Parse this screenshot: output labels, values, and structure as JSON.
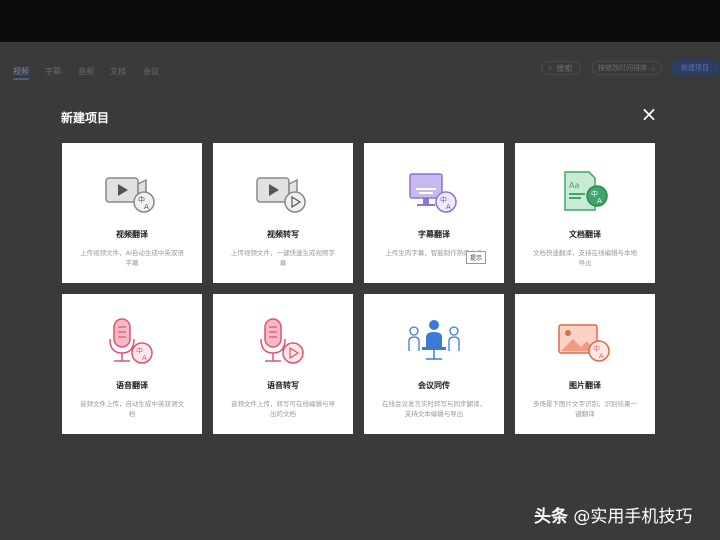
{
  "nav": {
    "tabs": [
      {
        "label": "视频",
        "active": true
      },
      {
        "label": "字幕",
        "active": false
      },
      {
        "label": "音频",
        "active": false
      },
      {
        "label": "文档",
        "active": false
      },
      {
        "label": "会议",
        "active": false
      }
    ],
    "search_label": "搜索",
    "sort_label": "按修改时间排序",
    "new_project_label": "新建项目"
  },
  "modal": {
    "title": "新建项目",
    "close_icon": "×",
    "cards": [
      {
        "icon": "video-translate-icon",
        "title": "视频翻译",
        "desc": "上传视频文件，AI自动生成中英双语字幕"
      },
      {
        "icon": "video-transcribe-icon",
        "title": "视频转写",
        "desc": "上传视频文件，一键快速生成视频字幕"
      },
      {
        "icon": "subtitle-translate-icon",
        "title": "字幕翻译",
        "desc": "上传生肉字幕，智能制作熟肉文件"
      },
      {
        "icon": "document-translate-icon",
        "title": "文档翻译",
        "desc": "文档快速翻译，支持在线编辑与本地导出"
      },
      {
        "icon": "audio-translate-icon",
        "title": "语音翻译",
        "desc": "音频文件上传，自动生成中英双语文档"
      },
      {
        "icon": "audio-transcribe-icon",
        "title": "语音转写",
        "desc": "音频文件上传，转写可在线编辑与导出的文档"
      },
      {
        "icon": "meeting-interpret-icon",
        "title": "会议同传",
        "desc": "在线会议发言实时转写与同步翻译，支持文本编辑与导出"
      },
      {
        "icon": "image-translate-icon",
        "title": "图片翻译",
        "desc": "多场景下图片文字识别，识别结果一键翻译"
      }
    ],
    "tooltip": "提示"
  },
  "watermark": {
    "brand": "头条",
    "handle": "@实用手机技巧"
  },
  "colors": {
    "page_bg": "#3a3a3a",
    "topbar_bg": "#0b0b0b",
    "accent_blue": "#4a5a8c",
    "card_bg": "#ffffff"
  }
}
